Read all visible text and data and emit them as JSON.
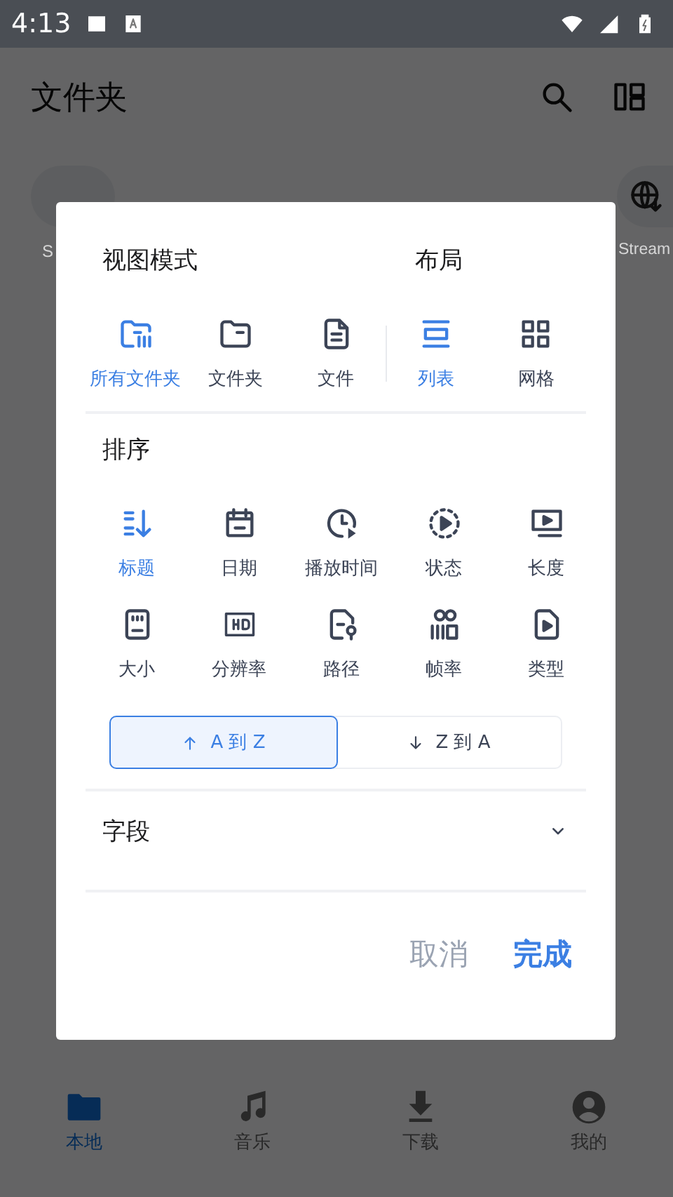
{
  "status_bar": {
    "time": "4:13"
  },
  "app_bar": {
    "title": "文件夹"
  },
  "chips": [
    {
      "label": "S"
    },
    {
      "label": "Stream"
    }
  ],
  "dialog": {
    "view_mode": {
      "title": "视图模式",
      "options": [
        {
          "label": "所有文件夹",
          "selected": true
        },
        {
          "label": "文件夹",
          "selected": false
        },
        {
          "label": "文件",
          "selected": false
        }
      ]
    },
    "layout": {
      "title": "布局",
      "options": [
        {
          "label": "列表",
          "selected": true
        },
        {
          "label": "网格",
          "selected": false
        }
      ]
    },
    "sort": {
      "title": "排序",
      "options": [
        {
          "label": "标题",
          "selected": true
        },
        {
          "label": "日期",
          "selected": false
        },
        {
          "label": "播放时间",
          "selected": false
        },
        {
          "label": "状态",
          "selected": false
        },
        {
          "label": "长度",
          "selected": false
        },
        {
          "label": "大小",
          "selected": false
        },
        {
          "label": "分辨率",
          "selected": false
        },
        {
          "label": "路径",
          "selected": false
        },
        {
          "label": "帧率",
          "selected": false
        },
        {
          "label": "类型",
          "selected": false
        }
      ],
      "order": [
        {
          "label": "A 到 Z",
          "kind": "ascending",
          "selected": true
        },
        {
          "label": "Z 到 A",
          "kind": "descending",
          "selected": false
        }
      ]
    },
    "fields": {
      "label": "字段",
      "expanded": false
    },
    "buttons": [
      {
        "label": "取消",
        "kind": "cancel"
      },
      {
        "label": "完成",
        "kind": "confirm"
      }
    ]
  },
  "bottom_nav": [
    {
      "label": "本地",
      "selected": true
    },
    {
      "label": "音乐",
      "selected": false
    },
    {
      "label": "下载",
      "selected": false
    },
    {
      "label": "我的",
      "selected": false
    }
  ]
}
